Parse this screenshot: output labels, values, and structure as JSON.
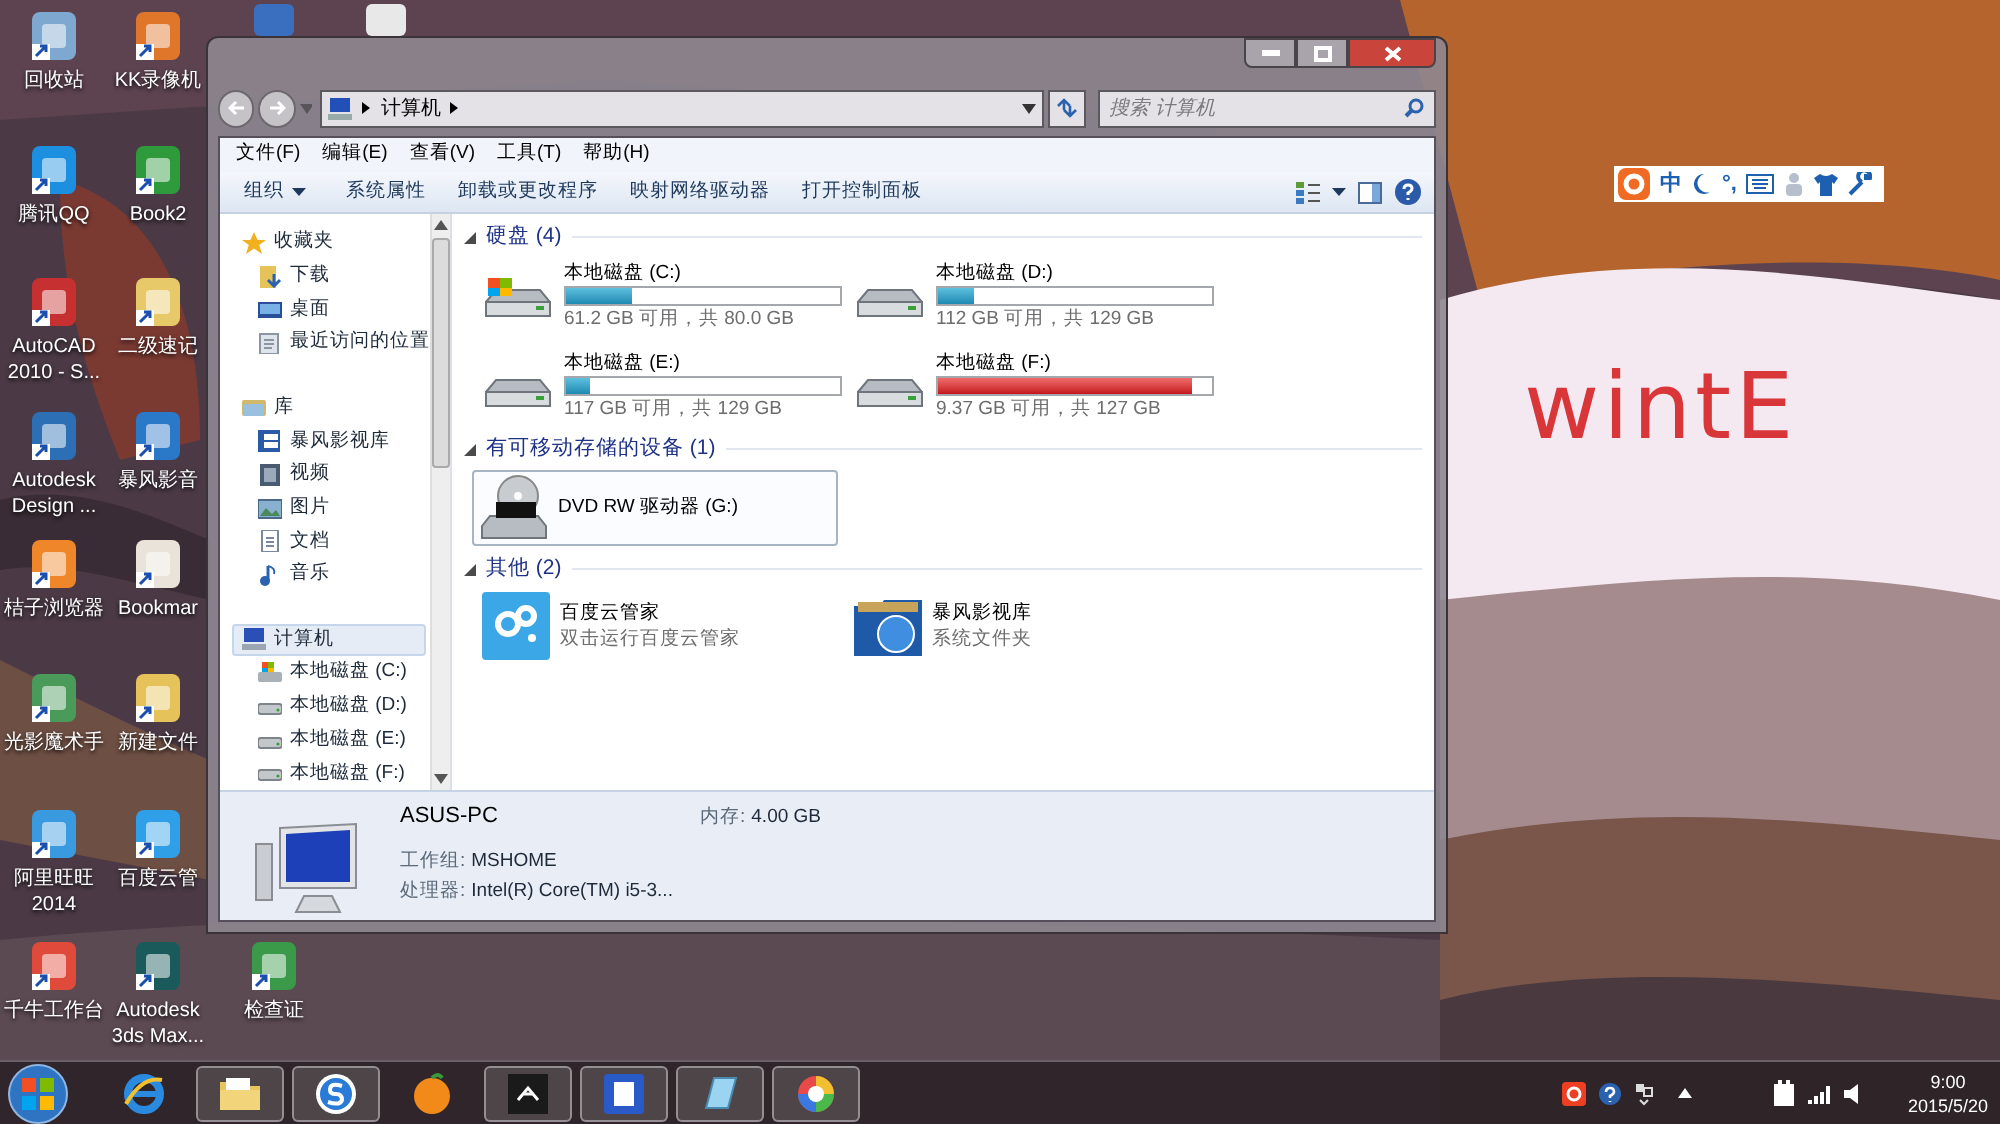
{
  "desktop_icons": [
    {
      "label": "回收站"
    },
    {
      "label": "KK录像机"
    },
    {
      "label": "腾讯QQ"
    },
    {
      "label": "Book2"
    },
    {
      "label": "AutoCAD\n2010 - S..."
    },
    {
      "label": "二级速记"
    },
    {
      "label": "Autodesk\nDesign ..."
    },
    {
      "label": "暴风影音"
    },
    {
      "label": "桔子浏览器"
    },
    {
      "label": "Bookmar"
    },
    {
      "label": "光影魔术手"
    },
    {
      "label": "新建文件"
    },
    {
      "label": "阿里旺旺\n2014"
    },
    {
      "label": "百度云管"
    },
    {
      "label": "千牛工作台"
    },
    {
      "label": "Autodesk\n3ds Max..."
    },
    {
      "label": "检查证"
    }
  ],
  "ime_bar": {
    "mode": "中",
    "punctuation": "°,"
  },
  "annotation": "wintE",
  "window": {
    "address": "计算机",
    "search": {
      "placeholder": "搜索 计算机"
    },
    "menu": [
      "文件(F)",
      "编辑(E)",
      "查看(V)",
      "工具(T)",
      "帮助(H)"
    ],
    "toolbar": [
      "组织",
      "系统属性",
      "卸载或更改程序",
      "映射网络驱动器",
      "打开控制面板"
    ],
    "nav": [
      {
        "label": "收藏夹",
        "kind": "star",
        "selected": false,
        "children": [
          {
            "label": "下载",
            "kind": "download",
            "selected": false
          },
          {
            "label": "桌面",
            "kind": "desktop",
            "selected": false
          },
          {
            "label": "最近访问的位置",
            "kind": "recent",
            "selected": false
          }
        ]
      },
      {
        "label": "库",
        "kind": "library",
        "selected": false,
        "children": [
          {
            "label": "暴风影视库",
            "kind": "film",
            "selected": false
          },
          {
            "label": "视频",
            "kind": "video",
            "selected": false
          },
          {
            "label": "图片",
            "kind": "picture",
            "selected": false
          },
          {
            "label": "文档",
            "kind": "document",
            "selected": false
          },
          {
            "label": "音乐",
            "kind": "music",
            "selected": false
          }
        ]
      },
      {
        "label": "计算机",
        "kind": "computer",
        "selected": true,
        "children": [
          {
            "label": "本地磁盘 (C:)",
            "kind": "system_drive",
            "selected": false
          },
          {
            "label": "本地磁盘 (D:)",
            "kind": "drive",
            "selected": false
          },
          {
            "label": "本地磁盘 (E:)",
            "kind": "drive",
            "selected": false
          },
          {
            "label": "本地磁盘 (F:)",
            "kind": "drive",
            "selected": false
          }
        ]
      }
    ],
    "hard_disks": {
      "title": "硬盘 (4)",
      "items": [
        {
          "name": "本地磁盘 (C:)",
          "kind": "system",
          "level": 0.24,
          "low_space": false,
          "free": "61.2 GB 可用，共 80.0 GB"
        },
        {
          "name": "本地磁盘 (D:)",
          "kind": "data",
          "level": 0.13,
          "low_space": false,
          "free": "112 GB 可用，共 129 GB"
        },
        {
          "name": "本地磁盘 (E:)",
          "kind": "data",
          "level": 0.09,
          "low_space": false,
          "free": "117 GB 可用，共 129 GB"
        },
        {
          "name": "本地磁盘 (F:)",
          "kind": "data",
          "level": 0.93,
          "low_space": true,
          "free": "9.37 GB 可用，共 127 GB"
        }
      ]
    },
    "removable": {
      "title": "有可移动存储的设备 (1)",
      "items": [
        {
          "name": "DVD RW 驱动器 (G:)",
          "selected": true
        }
      ]
    },
    "other": {
      "title": "其他 (2)",
      "items": [
        {
          "name": "百度云管家",
          "kind": "cloud",
          "description": "双击运行百度云管家"
        },
        {
          "name": "暴风影视库",
          "kind": "folder",
          "description": "系统文件夹"
        }
      ]
    },
    "details": {
      "name": "ASUS-PC",
      "memory_label": "内存:",
      "memory": "4.00 GB",
      "workgroup_label": "工作组:",
      "workgroup": "MSHOME",
      "cpu_label": "处理器:",
      "cpu": "Intel(R) Core(TM) i5-3..."
    }
  },
  "taskbar": {
    "apps": [
      {
        "kind": "ie",
        "running": false
      },
      {
        "kind": "explorer",
        "running": true
      },
      {
        "kind": "sogou",
        "running": true
      },
      {
        "kind": "orange",
        "running": false
      },
      {
        "kind": "dark",
        "running": true
      },
      {
        "kind": "word",
        "running": true
      },
      {
        "kind": "notes",
        "running": true
      },
      {
        "kind": "color",
        "running": true
      }
    ],
    "time": "9:00",
    "date": "2015/5/20"
  }
}
